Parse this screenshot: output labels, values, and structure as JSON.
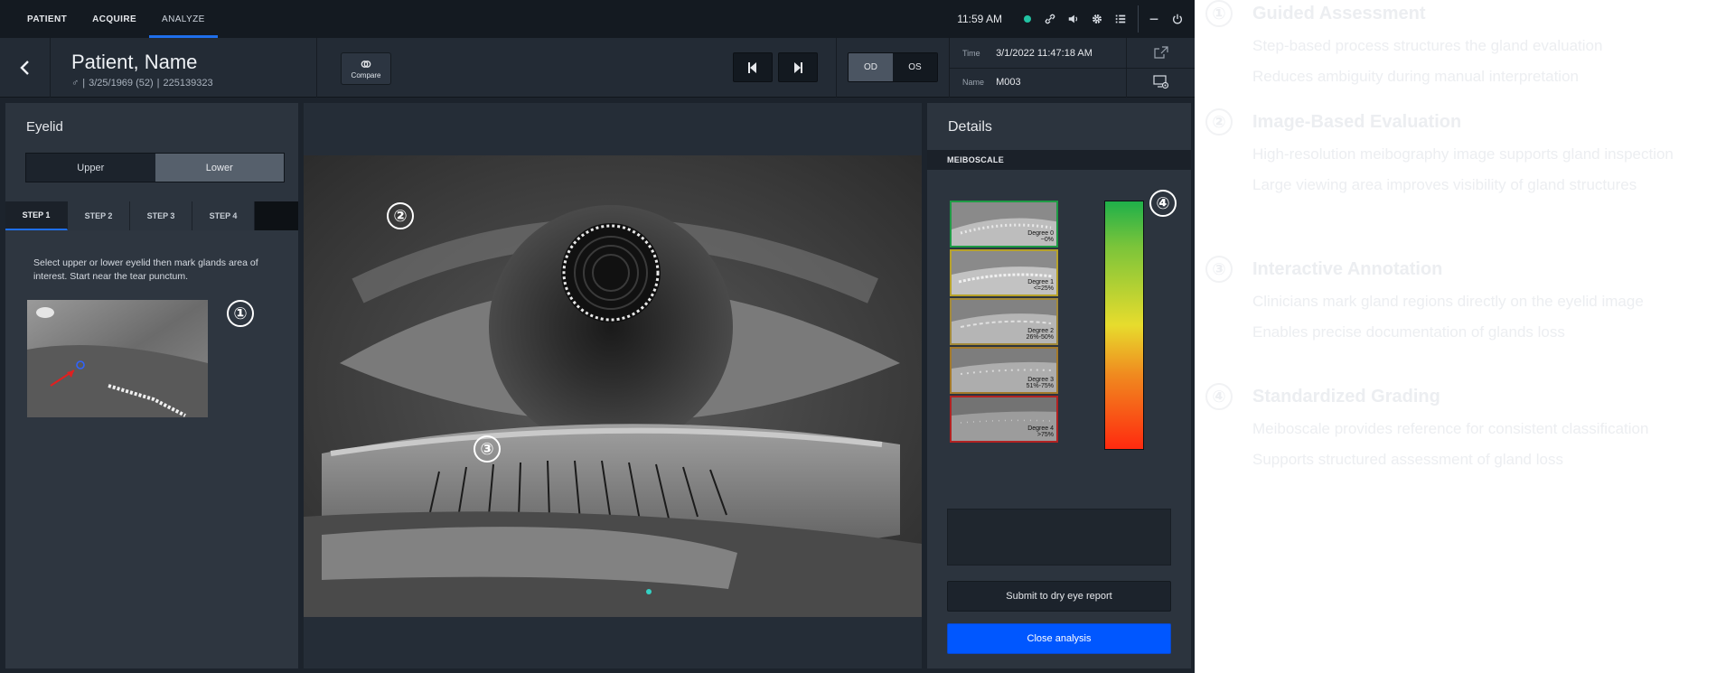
{
  "nav": {
    "tabs": [
      {
        "label": "PATIENT"
      },
      {
        "label": "ACQUIRE"
      },
      {
        "label": "ANALYZE"
      }
    ],
    "active_tab": "ANALYZE",
    "clock": "11:59 AM",
    "status_color": "#22c3a3"
  },
  "patient": {
    "name": "Patient, Name",
    "gender_symbol": "♂",
    "dob": "3/25/1969 (52)",
    "id": "225139323"
  },
  "toolbar": {
    "compare_label": "Compare",
    "eye_options": [
      "OD",
      "OS"
    ],
    "active_eye": "OD"
  },
  "meta": {
    "time_label": "Time",
    "time_value": "3/1/2022 11:47:18 AM",
    "name_label": "Name",
    "name_value": "M003"
  },
  "left_panel": {
    "title": "Eyelid",
    "eyelid_options": [
      "Upper",
      "Lower"
    ],
    "active_eyelid": "Lower",
    "steps": [
      "STEP 1",
      "STEP 2",
      "STEP 3",
      "STEP 4"
    ],
    "active_step": "STEP 1",
    "instruction": "Select upper or lower eyelid then mark glands area of interest. Start near the tear punctum."
  },
  "badges": [
    "①",
    "②",
    "③",
    "④"
  ],
  "right_panel": {
    "title": "Details",
    "section_label": "MEIBOSCALE",
    "degrees": [
      {
        "label": "Degree 0",
        "range": "~0%",
        "color": "#1f9b45"
      },
      {
        "label": "Degree 1",
        "range": "<=25%",
        "color": "#b7a22a"
      },
      {
        "label": "Degree 2",
        "range": "26%-50%",
        "color": "#a38a3a"
      },
      {
        "label": "Degree 3",
        "range": "51%-75%",
        "color": "#a3792a"
      },
      {
        "label": "Degree 4",
        "range": ">75%",
        "color": "#b22222"
      }
    ],
    "submit_label": "Submit to dry eye report",
    "close_label": "Close analysis",
    "accent_color": "#0057ff"
  },
  "annotations": [
    {
      "num": "①",
      "title": "Guided Assessment",
      "lines": [
        "Step-based process structures the gland evaluation",
        "Reduces ambiguity during manual interpretation"
      ]
    },
    {
      "num": "②",
      "title": "Image-Based Evaluation",
      "lines": [
        "High-resolution meibography image supports gland inspection",
        "Large viewing area improves visibility of gland structures"
      ]
    },
    {
      "num": "③",
      "title": "Interactive Annotation",
      "lines": [
        "Clinicians mark gland regions directly on the eyelid image",
        "Enables precise documentation of glands loss"
      ]
    },
    {
      "num": "④",
      "title": "Standardized Grading",
      "lines": [
        "Meiboscale provides reference for consistent classification",
        "Supports structured assessment of gland loss"
      ]
    }
  ]
}
